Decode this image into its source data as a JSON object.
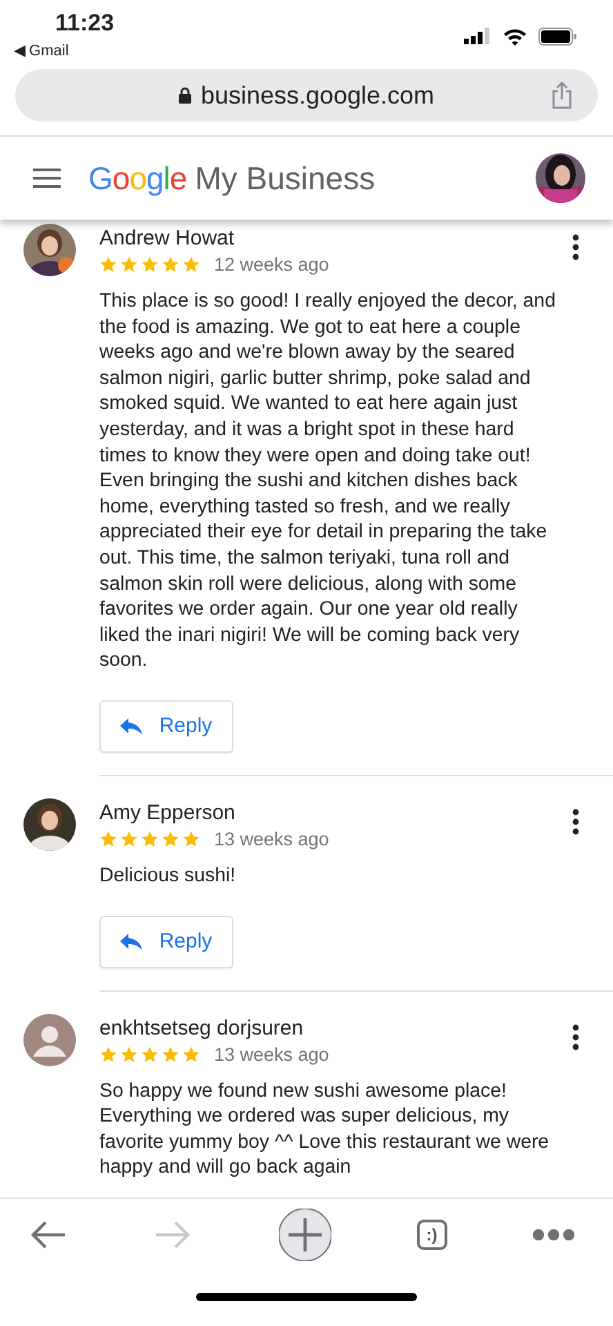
{
  "status_bar": {
    "time": "11:23",
    "back_app": "◀ Gmail"
  },
  "address_bar": {
    "url": "business.google.com"
  },
  "header": {
    "logo": "Google",
    "title": "My Business"
  },
  "reviews": [
    {
      "name": "Andrew Howat",
      "stars": 5,
      "time": "12 weeks ago",
      "text": "This place is so good! I really enjoyed the decor, and the food is amazing. We got to eat here a couple weeks ago and we're blown away by the seared salmon nigiri, garlic butter shrimp, poke salad and smoked squid. We wanted to eat here again just yesterday, and it was a bright spot in these hard times to know they were open and doing take out! Even bringing the sushi and kitchen dishes back home, everything tasted so fresh, and we really appreciated their eye for detail in preparing the take out. This time, the salmon teriyaki, tuna roll and salmon skin roll were delicious, along with some favorites we order again. Our one year old really liked the inari nigiri! We will be coming back very soon.",
      "reply": "Reply"
    },
    {
      "name": "Amy Epperson",
      "stars": 5,
      "time": "13 weeks ago",
      "text": "Delicious sushi!",
      "reply": "Reply"
    },
    {
      "name": "enkhtsetseg dorjsuren",
      "stars": 5,
      "time": "13 weeks ago",
      "text": "So happy we found new sushi awesome place! Everything we ordered was super delicious, my favorite yummy boy ^^ Love this restaurant we were happy and will go back again",
      "avatar": {
        "kind": "default"
      }
    }
  ],
  "toolbar": [
    {
      "kind": "back",
      "disabled": false
    },
    {
      "kind": "forward",
      "disabled": true
    },
    {
      "kind": "new_tab",
      "disabled": false
    },
    {
      "kind": "tabs",
      "label": ":)",
      "disabled": false
    },
    {
      "kind": "more",
      "disabled": false
    }
  ]
}
